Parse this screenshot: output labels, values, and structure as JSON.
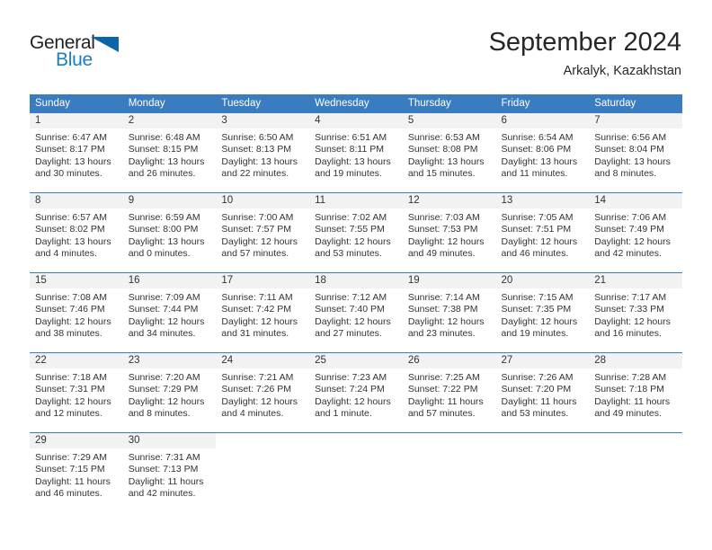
{
  "brand": {
    "word_top": "General",
    "word_bottom": "Blue",
    "triangle_color": "#0b65ab",
    "blue_text_color": "#1a7fc1"
  },
  "header": {
    "title": "September 2024",
    "subtitle": "Arkalyk, Kazakhstan"
  },
  "theme": {
    "header_blue": "#3a7cc0",
    "daynum_band": "#f2f2f2",
    "text": "#333333"
  },
  "calendar": {
    "weekday_headers": [
      "Sunday",
      "Monday",
      "Tuesday",
      "Wednesday",
      "Thursday",
      "Friday",
      "Saturday"
    ],
    "weeks": [
      [
        {
          "day": "1",
          "sunrise": "Sunrise: 6:47 AM",
          "sunset": "Sunset: 8:17 PM",
          "daylight1": "Daylight: 13 hours",
          "daylight2": "and 30 minutes."
        },
        {
          "day": "2",
          "sunrise": "Sunrise: 6:48 AM",
          "sunset": "Sunset: 8:15 PM",
          "daylight1": "Daylight: 13 hours",
          "daylight2": "and 26 minutes."
        },
        {
          "day": "3",
          "sunrise": "Sunrise: 6:50 AM",
          "sunset": "Sunset: 8:13 PM",
          "daylight1": "Daylight: 13 hours",
          "daylight2": "and 22 minutes."
        },
        {
          "day": "4",
          "sunrise": "Sunrise: 6:51 AM",
          "sunset": "Sunset: 8:11 PM",
          "daylight1": "Daylight: 13 hours",
          "daylight2": "and 19 minutes."
        },
        {
          "day": "5",
          "sunrise": "Sunrise: 6:53 AM",
          "sunset": "Sunset: 8:08 PM",
          "daylight1": "Daylight: 13 hours",
          "daylight2": "and 15 minutes."
        },
        {
          "day": "6",
          "sunrise": "Sunrise: 6:54 AM",
          "sunset": "Sunset: 8:06 PM",
          "daylight1": "Daylight: 13 hours",
          "daylight2": "and 11 minutes."
        },
        {
          "day": "7",
          "sunrise": "Sunrise: 6:56 AM",
          "sunset": "Sunset: 8:04 PM",
          "daylight1": "Daylight: 13 hours",
          "daylight2": "and 8 minutes."
        }
      ],
      [
        {
          "day": "8",
          "sunrise": "Sunrise: 6:57 AM",
          "sunset": "Sunset: 8:02 PM",
          "daylight1": "Daylight: 13 hours",
          "daylight2": "and 4 minutes."
        },
        {
          "day": "9",
          "sunrise": "Sunrise: 6:59 AM",
          "sunset": "Sunset: 8:00 PM",
          "daylight1": "Daylight: 13 hours",
          "daylight2": "and 0 minutes."
        },
        {
          "day": "10",
          "sunrise": "Sunrise: 7:00 AM",
          "sunset": "Sunset: 7:57 PM",
          "daylight1": "Daylight: 12 hours",
          "daylight2": "and 57 minutes."
        },
        {
          "day": "11",
          "sunrise": "Sunrise: 7:02 AM",
          "sunset": "Sunset: 7:55 PM",
          "daylight1": "Daylight: 12 hours",
          "daylight2": "and 53 minutes."
        },
        {
          "day": "12",
          "sunrise": "Sunrise: 7:03 AM",
          "sunset": "Sunset: 7:53 PM",
          "daylight1": "Daylight: 12 hours",
          "daylight2": "and 49 minutes."
        },
        {
          "day": "13",
          "sunrise": "Sunrise: 7:05 AM",
          "sunset": "Sunset: 7:51 PM",
          "daylight1": "Daylight: 12 hours",
          "daylight2": "and 46 minutes."
        },
        {
          "day": "14",
          "sunrise": "Sunrise: 7:06 AM",
          "sunset": "Sunset: 7:49 PM",
          "daylight1": "Daylight: 12 hours",
          "daylight2": "and 42 minutes."
        }
      ],
      [
        {
          "day": "15",
          "sunrise": "Sunrise: 7:08 AM",
          "sunset": "Sunset: 7:46 PM",
          "daylight1": "Daylight: 12 hours",
          "daylight2": "and 38 minutes."
        },
        {
          "day": "16",
          "sunrise": "Sunrise: 7:09 AM",
          "sunset": "Sunset: 7:44 PM",
          "daylight1": "Daylight: 12 hours",
          "daylight2": "and 34 minutes."
        },
        {
          "day": "17",
          "sunrise": "Sunrise: 7:11 AM",
          "sunset": "Sunset: 7:42 PM",
          "daylight1": "Daylight: 12 hours",
          "daylight2": "and 31 minutes."
        },
        {
          "day": "18",
          "sunrise": "Sunrise: 7:12 AM",
          "sunset": "Sunset: 7:40 PM",
          "daylight1": "Daylight: 12 hours",
          "daylight2": "and 27 minutes."
        },
        {
          "day": "19",
          "sunrise": "Sunrise: 7:14 AM",
          "sunset": "Sunset: 7:38 PM",
          "daylight1": "Daylight: 12 hours",
          "daylight2": "and 23 minutes."
        },
        {
          "day": "20",
          "sunrise": "Sunrise: 7:15 AM",
          "sunset": "Sunset: 7:35 PM",
          "daylight1": "Daylight: 12 hours",
          "daylight2": "and 19 minutes."
        },
        {
          "day": "21",
          "sunrise": "Sunrise: 7:17 AM",
          "sunset": "Sunset: 7:33 PM",
          "daylight1": "Daylight: 12 hours",
          "daylight2": "and 16 minutes."
        }
      ],
      [
        {
          "day": "22",
          "sunrise": "Sunrise: 7:18 AM",
          "sunset": "Sunset: 7:31 PM",
          "daylight1": "Daylight: 12 hours",
          "daylight2": "and 12 minutes."
        },
        {
          "day": "23",
          "sunrise": "Sunrise: 7:20 AM",
          "sunset": "Sunset: 7:29 PM",
          "daylight1": "Daylight: 12 hours",
          "daylight2": "and 8 minutes."
        },
        {
          "day": "24",
          "sunrise": "Sunrise: 7:21 AM",
          "sunset": "Sunset: 7:26 PM",
          "daylight1": "Daylight: 12 hours",
          "daylight2": "and 4 minutes."
        },
        {
          "day": "25",
          "sunrise": "Sunrise: 7:23 AM",
          "sunset": "Sunset: 7:24 PM",
          "daylight1": "Daylight: 12 hours",
          "daylight2": "and 1 minute."
        },
        {
          "day": "26",
          "sunrise": "Sunrise: 7:25 AM",
          "sunset": "Sunset: 7:22 PM",
          "daylight1": "Daylight: 11 hours",
          "daylight2": "and 57 minutes."
        },
        {
          "day": "27",
          "sunrise": "Sunrise: 7:26 AM",
          "sunset": "Sunset: 7:20 PM",
          "daylight1": "Daylight: 11 hours",
          "daylight2": "and 53 minutes."
        },
        {
          "day": "28",
          "sunrise": "Sunrise: 7:28 AM",
          "sunset": "Sunset: 7:18 PM",
          "daylight1": "Daylight: 11 hours",
          "daylight2": "and 49 minutes."
        }
      ],
      [
        {
          "day": "29",
          "sunrise": "Sunrise: 7:29 AM",
          "sunset": "Sunset: 7:15 PM",
          "daylight1": "Daylight: 11 hours",
          "daylight2": "and 46 minutes."
        },
        {
          "day": "30",
          "sunrise": "Sunrise: 7:31 AM",
          "sunset": "Sunset: 7:13 PM",
          "daylight1": "Daylight: 11 hours",
          "daylight2": "and 42 minutes."
        },
        {
          "day": "",
          "sunrise": "",
          "sunset": "",
          "daylight1": "",
          "daylight2": ""
        },
        {
          "day": "",
          "sunrise": "",
          "sunset": "",
          "daylight1": "",
          "daylight2": ""
        },
        {
          "day": "",
          "sunrise": "",
          "sunset": "",
          "daylight1": "",
          "daylight2": ""
        },
        {
          "day": "",
          "sunrise": "",
          "sunset": "",
          "daylight1": "",
          "daylight2": ""
        },
        {
          "day": "",
          "sunrise": "",
          "sunset": "",
          "daylight1": "",
          "daylight2": ""
        }
      ]
    ]
  }
}
